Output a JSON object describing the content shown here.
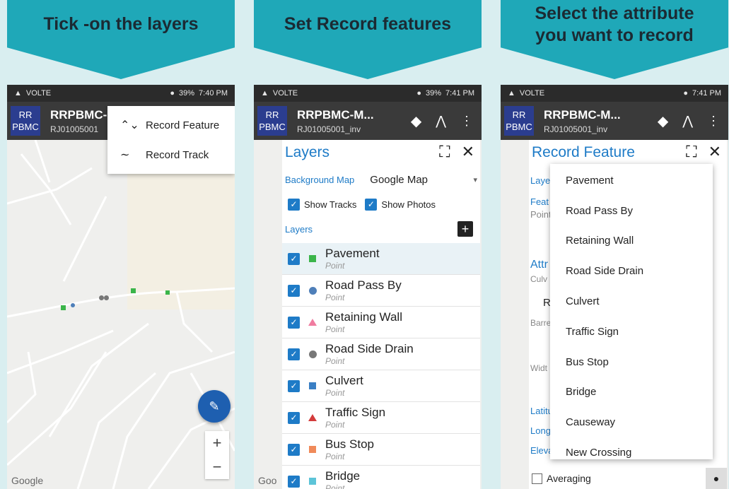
{
  "banners": [
    "Tick -on the layers",
    "Set Record features",
    "Select the attribute\nyou want to record"
  ],
  "status": {
    "times": [
      "7:40 PM",
      "7:41 PM",
      "7:41 PM"
    ],
    "battery": "39%",
    "network": "VOLTE"
  },
  "app": {
    "logo_line1": "RR",
    "logo_line2": "PBMC",
    "title": "RRPBMC-M...",
    "title_panel1": "RRPBMC-",
    "subtitle": "RJ01005001_inv",
    "subtitle_panel1": "RJ01005001"
  },
  "menu": {
    "record_feature": "Record Feature",
    "record_track": "Record Track"
  },
  "map": {
    "google_label": "Google",
    "zoom_in": "+",
    "zoom_out": "−"
  },
  "layers_panel": {
    "title": "Layers",
    "background_label": "Background Map",
    "background_value": "Google Map",
    "show_tracks": "Show Tracks",
    "show_photos": "Show Photos",
    "layers_label": "Layers",
    "items": [
      {
        "name": "Pavement",
        "geom": "Point",
        "color": "#3bb54a",
        "shape": "square"
      },
      {
        "name": "Road Pass By",
        "geom": "Point",
        "color": "#4e7fb9",
        "shape": "circle"
      },
      {
        "name": "Retaining Wall",
        "geom": "Point",
        "color": "#f07ca0",
        "shape": "triangle"
      },
      {
        "name": "Road Side Drain",
        "geom": "Point",
        "color": "#777777",
        "shape": "circle"
      },
      {
        "name": "Culvert",
        "geom": "Point",
        "color": "#3a7fc4",
        "shape": "square"
      },
      {
        "name": "Traffic Sign",
        "geom": "Point",
        "color": "#d33b3b",
        "shape": "triangle"
      },
      {
        "name": "Bus Stop",
        "geom": "Point",
        "color": "#f08a5a",
        "shape": "square"
      },
      {
        "name": "Bridge",
        "geom": "Point",
        "color": "#5cc4d8",
        "shape": "square"
      }
    ]
  },
  "record_panel": {
    "title": "Record Feature",
    "partial_labels": [
      "Layer",
      "Feat",
      "Point",
      "Attr",
      "Culv",
      "R",
      "Barre",
      "Widt",
      "Latitu",
      "Longi",
      "Eleva"
    ],
    "options": [
      "Pavement",
      "Road Pass By",
      "Retaining Wall",
      "Road Side Drain",
      "Culvert",
      "Traffic Sign",
      "Bus Stop",
      "Bridge",
      "Causeway",
      "New Crossing"
    ],
    "averaging": "Averaging",
    "google_partial": "Goo"
  }
}
